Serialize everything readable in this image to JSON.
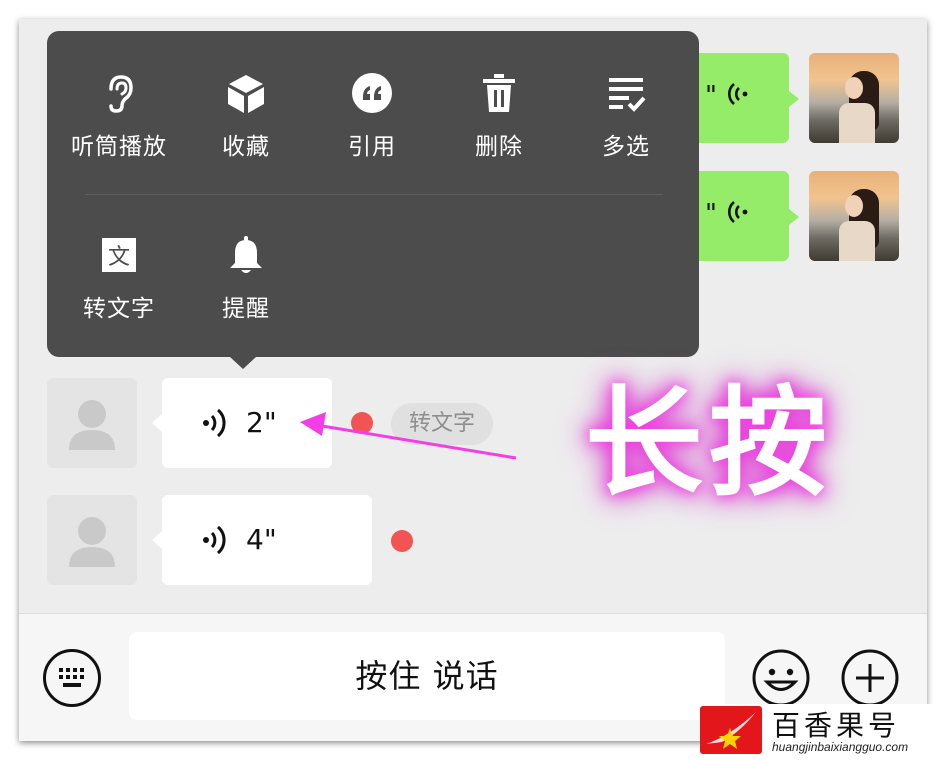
{
  "menu": {
    "items": [
      {
        "label": "听筒播放",
        "icon": "ear-icon"
      },
      {
        "label": "收藏",
        "icon": "cube-icon"
      },
      {
        "label": "引用",
        "icon": "quote-icon"
      },
      {
        "label": "删除",
        "icon": "trash-icon"
      },
      {
        "label": "多选",
        "icon": "multi-select-icon"
      },
      {
        "label": "转文字",
        "icon": "translate-text-icon"
      },
      {
        "label": "提醒",
        "icon": "bell-icon"
      }
    ]
  },
  "messages": {
    "sent": [
      {
        "duration": "\"",
        "icon": "voice-wave-icon"
      },
      {
        "duration": "\"",
        "icon": "voice-wave-icon"
      }
    ],
    "received": [
      {
        "duration": "2\"",
        "unread": true,
        "to_text_label": "转文字"
      },
      {
        "duration": "4\"",
        "unread": true
      }
    ]
  },
  "annotation": {
    "label": "长按",
    "arrow_color": "#f33ee8"
  },
  "bottom_bar": {
    "talk_label": "按住 说话"
  },
  "watermark": {
    "title": "百香果号",
    "url": "huangjinbaixiangguo.com"
  },
  "colors": {
    "sent_bubble": "#95ec69",
    "menu_bg": "#4c4c4c",
    "unread_dot": "#f25353"
  }
}
